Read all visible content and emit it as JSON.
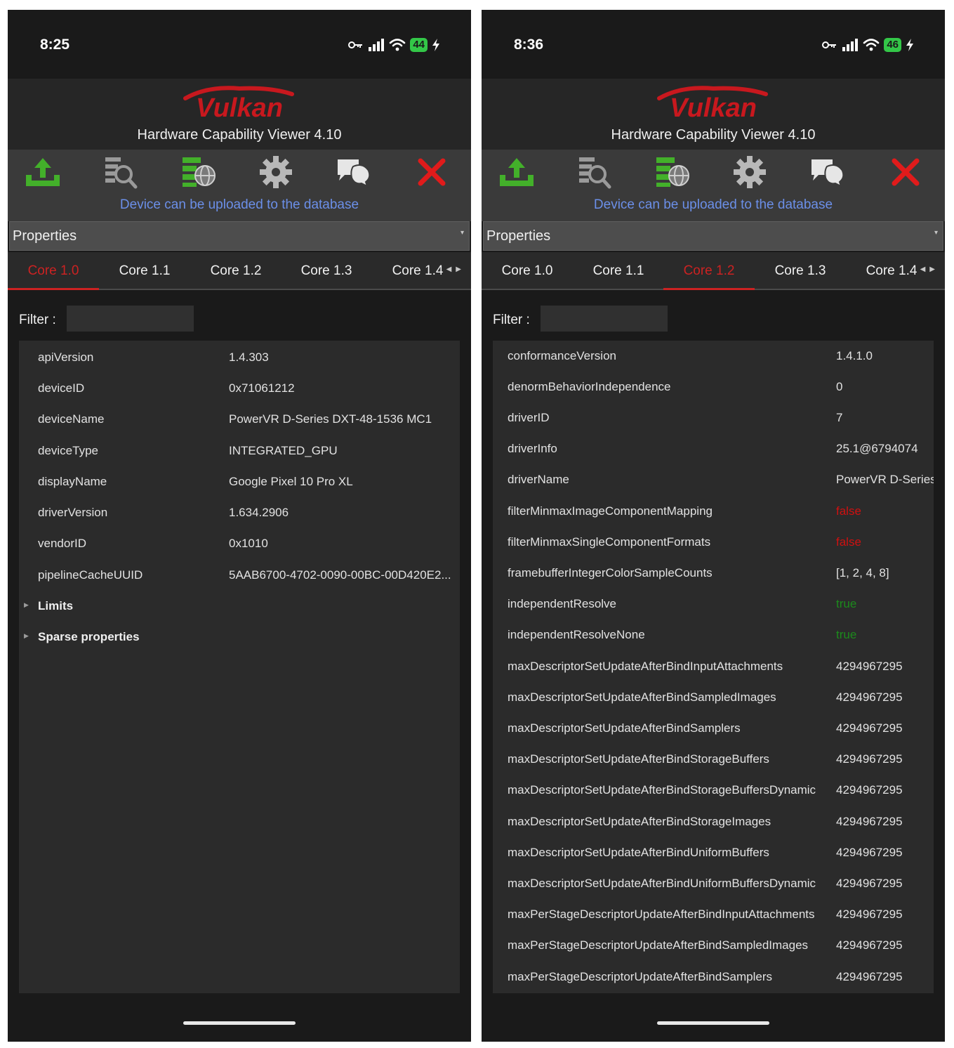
{
  "screens": [
    {
      "status": {
        "time": "8:25",
        "battery": "44"
      },
      "app": {
        "logo": "Vulkan",
        "title": "Hardware Capability Viewer 4.10"
      },
      "toolbar": {
        "icons": [
          "upload-icon",
          "search-report-icon",
          "database-globe-icon",
          "settings-gear-icon",
          "chat-bubbles-icon",
          "close-x-icon"
        ],
        "colors": {
          "upload": "#43b02a",
          "close": "#e01b1b",
          "gear": "#b8b8b8"
        }
      },
      "upload_status": "Device can be uploaded to the database",
      "dropdown": {
        "selected": "Properties"
      },
      "tabs": [
        "Core 1.0",
        "Core 1.1",
        "Core 1.2",
        "Core 1.3",
        "Core 1.4"
      ],
      "active_tab": "Core 1.0",
      "filter": {
        "label": "Filter :",
        "value": ""
      },
      "properties": [
        {
          "key": "apiVersion",
          "value": "1.4.303"
        },
        {
          "key": "deviceID",
          "value": "0x71061212"
        },
        {
          "key": "deviceName",
          "value": "PowerVR D-Series DXT-48-1536 MC1"
        },
        {
          "key": "deviceType",
          "value": "INTEGRATED_GPU"
        },
        {
          "key": "displayName",
          "value": "Google Pixel 10 Pro XL"
        },
        {
          "key": "driverVersion",
          "value": "1.634.2906"
        },
        {
          "key": "vendorID",
          "value": "0x1010"
        },
        {
          "key": "pipelineCacheUUID",
          "value": "5AAB6700-4702-0090-00BC-00D420E2..."
        }
      ],
      "groups": [
        "Limits",
        "Sparse properties"
      ]
    },
    {
      "status": {
        "time": "8:36",
        "battery": "46"
      },
      "app": {
        "logo": "Vulkan",
        "title": "Hardware Capability Viewer 4.10"
      },
      "toolbar": {
        "icons": [
          "upload-icon",
          "search-report-icon",
          "database-globe-icon",
          "settings-gear-icon",
          "chat-bubbles-icon",
          "close-x-icon"
        ],
        "colors": {
          "upload": "#43b02a",
          "close": "#e01b1b",
          "gear": "#b8b8b8"
        }
      },
      "upload_status": "Device can be uploaded to the database",
      "dropdown": {
        "selected": "Properties"
      },
      "tabs": [
        "Core 1.0",
        "Core 1.1",
        "Core 1.2",
        "Core 1.3",
        "Core 1.4"
      ],
      "active_tab": "Core 1.2",
      "filter": {
        "label": "Filter :",
        "value": ""
      },
      "properties": [
        {
          "key": "conformanceVersion",
          "value": "1.4.1.0"
        },
        {
          "key": "denormBehaviorIndependence",
          "value": "0"
        },
        {
          "key": "driverID",
          "value": "7"
        },
        {
          "key": "driverInfo",
          "value": "25.1@6794074"
        },
        {
          "key": "driverName",
          "value": "PowerVR D-Series"
        },
        {
          "key": "filterMinmaxImageComponentMapping",
          "value": "false"
        },
        {
          "key": "filterMinmaxSingleComponentFormats",
          "value": "false"
        },
        {
          "key": "framebufferIntegerColorSampleCounts",
          "value": "[1, 2, 4, 8]"
        },
        {
          "key": "independentResolve",
          "value": "true"
        },
        {
          "key": "independentResolveNone",
          "value": "true"
        },
        {
          "key": "maxDescriptorSetUpdateAfterBindInputAttachments",
          "value": "4294967295"
        },
        {
          "key": "maxDescriptorSetUpdateAfterBindSampledImages",
          "value": "4294967295"
        },
        {
          "key": "maxDescriptorSetUpdateAfterBindSamplers",
          "value": "4294967295"
        },
        {
          "key": "maxDescriptorSetUpdateAfterBindStorageBuffers",
          "value": "4294967295"
        },
        {
          "key": "maxDescriptorSetUpdateAfterBindStorageBuffersDynamic",
          "value": "4294967295"
        },
        {
          "key": "maxDescriptorSetUpdateAfterBindStorageImages",
          "value": "4294967295"
        },
        {
          "key": "maxDescriptorSetUpdateAfterBindUniformBuffers",
          "value": "4294967295"
        },
        {
          "key": "maxDescriptorSetUpdateAfterBindUniformBuffersDynamic",
          "value": "4294967295"
        },
        {
          "key": "maxPerStageDescriptorUpdateAfterBindInputAttachments",
          "value": "4294967295"
        },
        {
          "key": "maxPerStageDescriptorUpdateAfterBindSampledImages",
          "value": "4294967295"
        },
        {
          "key": "maxPerStageDescriptorUpdateAfterBindSamplers",
          "value": "4294967295"
        }
      ],
      "groups": []
    }
  ]
}
